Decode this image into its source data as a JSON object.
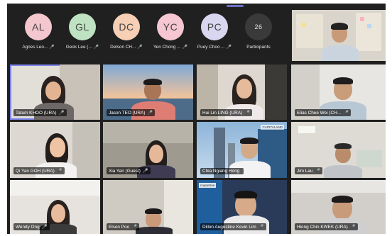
{
  "colors": {
    "stage_bg": "#1f1f1f",
    "active_outline": "#7b83eb"
  },
  "avatars": [
    {
      "initials": "AL",
      "name": "Agnes Leo...",
      "color": "#f4c7ce"
    },
    {
      "initials": "GL",
      "name": "Geok Lee (...",
      "color": "#bfe3c2"
    },
    {
      "initials": "DC",
      "name": "Delson CH...",
      "color": "#f7cfb5"
    },
    {
      "initials": "YC",
      "name": "Yen Chong ...",
      "color": "#f6c6d3"
    },
    {
      "initials": "PC",
      "name": "Puey Choo ...",
      "color": "#d9d6f0"
    }
  ],
  "participants": {
    "count": "26",
    "label": "Participants"
  },
  "pinned_video": {
    "label": ""
  },
  "tiles": [
    {
      "label": "Tatum KHOO (URA)",
      "mic": "🎤"
    },
    {
      "label": "Jason TEO (URA)",
      "mic": "🎤"
    },
    {
      "label": "Hui Lin LING (URA)",
      "mic": "🎤"
    },
    {
      "label": "Elias Chee Wei (CH...",
      "mic": "🎤"
    },
    {
      "label": "Qi Yan GOH (URA)",
      "mic": "🎤"
    },
    {
      "label": "Xia Yan (Guest)",
      "mic": "🎤"
    },
    {
      "label": "Chia Ngiang Hong",
      "mic": ""
    },
    {
      "label": "Jim Lau",
      "mic": "🎤"
    },
    {
      "label": "Wendy Ong",
      "mic": "🎤"
    },
    {
      "label": "Elson Poo",
      "mic": "🎤"
    },
    {
      "label": "Dillon Augustine Kevin Lim",
      "mic": "🎤"
    },
    {
      "label": "Hiong Chin KWEK (URA)",
      "mic": "🎤"
    }
  ],
  "background_text": {
    "capitaland": "CAPITALAND",
    "mapletree": "mapletree"
  }
}
